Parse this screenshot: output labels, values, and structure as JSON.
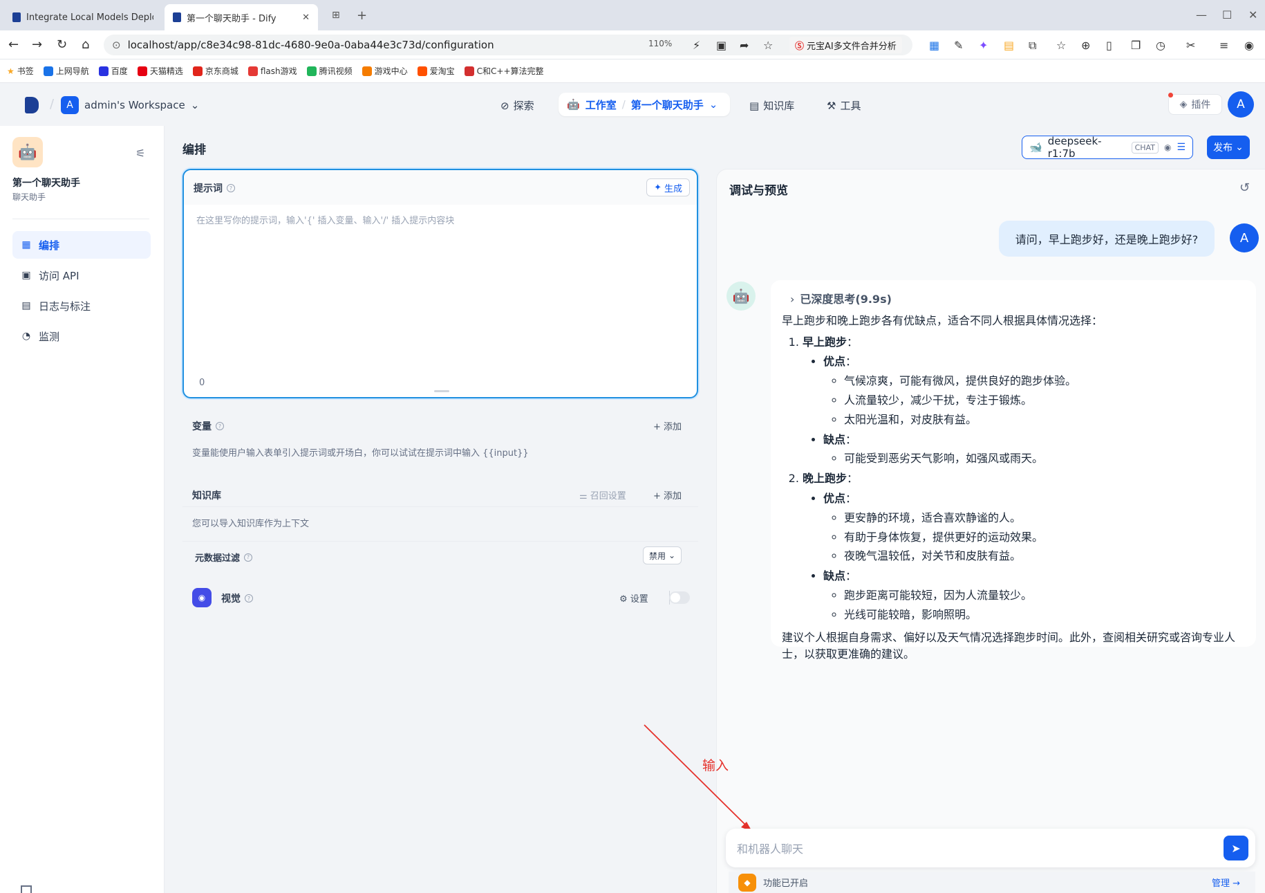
{
  "browser": {
    "tabs": [
      {
        "label": "Integrate Local Models Deploye"
      },
      {
        "label": "第一个聊天助手 - Dify"
      }
    ],
    "url": "localhost/app/c8e34c98-81dc-4680-9e0a-0aba44e3c73d/configuration",
    "zoom": "110%",
    "ext_pill": "元宝AI多文件合并分析",
    "bookmarks": [
      "书签",
      "上网导航",
      "百度",
      "天猫精选",
      "京东商城",
      "flash游戏",
      "腾讯视频",
      "游戏中心",
      "爱淘宝",
      "C和C++算法完整"
    ]
  },
  "header": {
    "workspace_initial": "A",
    "workspace_name": "admin's Workspace",
    "nav": {
      "explore": "探索",
      "studio": "工作室",
      "current_app": "第一个聊天助手",
      "knowledge": "知识库",
      "tools": "工具"
    },
    "plugins": "插件",
    "user_initial": "A"
  },
  "sidebar": {
    "app_name": "第一个聊天助手",
    "app_type": "聊天助手",
    "items": [
      {
        "label": "编排"
      },
      {
        "label": "访问 API"
      },
      {
        "label": "日志与标注"
      },
      {
        "label": "监测"
      }
    ]
  },
  "config": {
    "title": "编排",
    "model_name": "deepseek-r1:7b",
    "model_mode": "CHAT",
    "publish": "发布",
    "prompt": {
      "label": "提示词",
      "generate": "生成",
      "placeholder": "在这里写你的提示词，输入'{' 插入变量、输入'/' 插入提示内容块",
      "count": "0"
    },
    "variables": {
      "label": "变量",
      "add": "添加",
      "hint": "变量能使用户输入表单引入提示词或开场白，你可以试试在提示词中输入 {{input}}"
    },
    "knowledge": {
      "label": "知识库",
      "recall": "召回设置",
      "add": "添加",
      "hint": "您可以导入知识库作为上下文",
      "metadata_filter": "元数据过滤",
      "metadata_value": "禁用"
    },
    "vision": {
      "label": "视觉",
      "settings": "设置"
    }
  },
  "debug": {
    "title": "调试与预览",
    "user_initial": "A",
    "question": "请问，早上跑步好，还是晚上跑步好?",
    "thinking": "已深度思考(9.9s)",
    "intro": "早上跑步和晚上跑步各有优缺点，适合不同人根据具体情况选择：",
    "sections": [
      {
        "title": "早上跑步",
        "pros_label": "优点",
        "pros": [
          "气候凉爽，可能有微风，提供良好的跑步体验。",
          "人流量较少，减少干扰，专注于锻炼。",
          "太阳光温和，对皮肤有益。"
        ],
        "cons_label": "缺点",
        "cons": [
          "可能受到恶劣天气影响，如强风或雨天。"
        ]
      },
      {
        "title": "晚上跑步",
        "pros_label": "优点",
        "pros": [
          "更安静的环境，适合喜欢静谧的人。",
          "有助于身体恢复，提供更好的运动效果。",
          "夜晚气温较低，对关节和皮肤有益。"
        ],
        "cons_label": "缺点",
        "cons": [
          "跑步距离可能较短，因为人流量较少。",
          "光线可能较暗，影响照明。"
        ]
      }
    ],
    "conclusion": "建议个人根据自身需求、偏好以及天气情况选择跑步时间。此外，查阅相关研究或咨询专业人士，以获取更准确的建议。",
    "annotation": "输入",
    "input_placeholder": "和机器人聊天",
    "features_on": "功能已开启",
    "manage": "管理"
  },
  "colors": {
    "primary": "#155eef",
    "annotation": "#e5312b"
  }
}
